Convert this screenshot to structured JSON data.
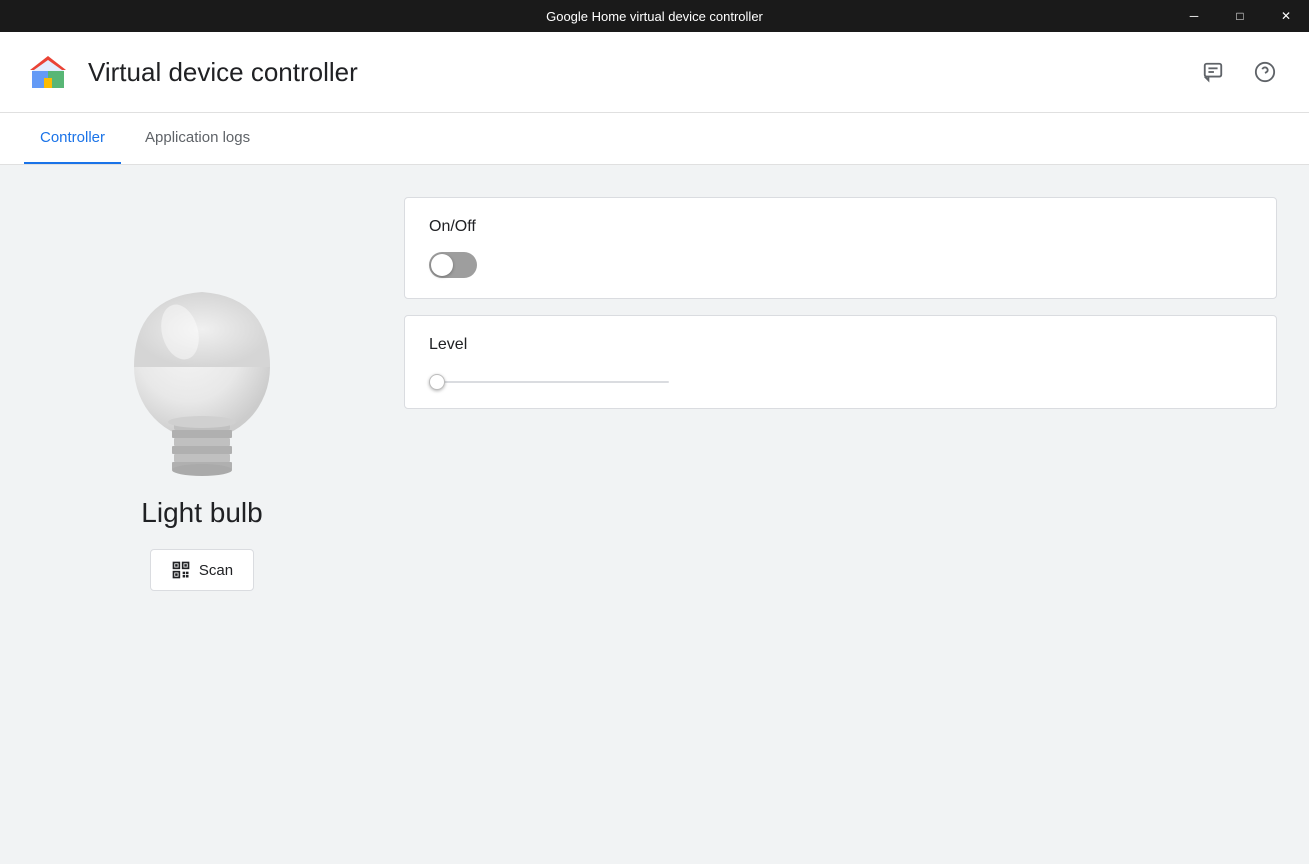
{
  "titleBar": {
    "title": "Google Home virtual device controller",
    "minimize": "─",
    "maximize": "□",
    "close": "✕"
  },
  "header": {
    "appTitle": "Virtual device controller",
    "chatIconLabel": "chat-icon",
    "helpIconLabel": "help-icon"
  },
  "tabs": [
    {
      "id": "controller",
      "label": "Controller",
      "active": true
    },
    {
      "id": "application-logs",
      "label": "Application logs",
      "active": false
    }
  ],
  "device": {
    "name": "Light bulb",
    "scanButtonLabel": "Scan"
  },
  "controls": {
    "onOff": {
      "label": "On/Off",
      "state": false
    },
    "level": {
      "label": "Level",
      "value": 0,
      "min": 0,
      "max": 100
    }
  }
}
